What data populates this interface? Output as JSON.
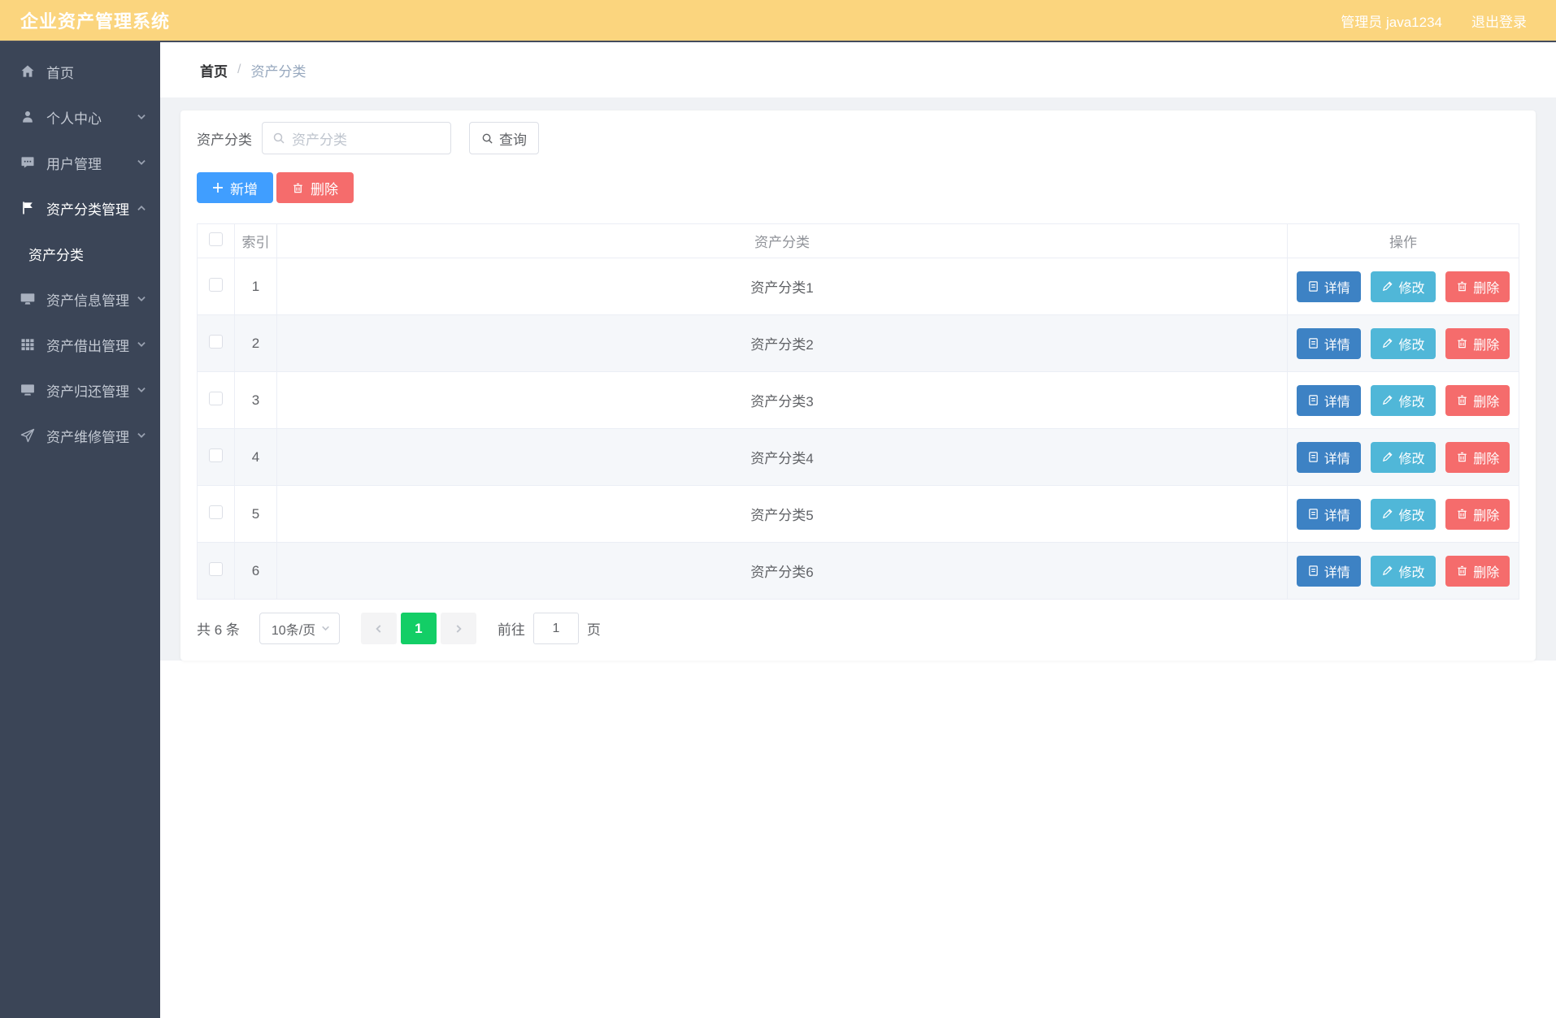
{
  "colors": {
    "header_bg": "#fbd57e",
    "sidebar_bg": "#3b4557",
    "primary_blue": "#409eff",
    "danger_red": "#f56c6c",
    "detail_blue": "#3d82c4",
    "edit_cyan": "#50b7d8",
    "active_page_green": "#13ce66"
  },
  "header": {
    "title": "企业资产管理系统",
    "user": "管理员 java1234",
    "logout": "退出登录"
  },
  "sidebar": {
    "items": [
      {
        "label": "首页",
        "icon": "home-icon"
      },
      {
        "label": "个人中心",
        "icon": "user-icon"
      },
      {
        "label": "用户管理",
        "icon": "chat-icon"
      },
      {
        "label": "资产分类管理",
        "icon": "flag-icon",
        "expanded": true,
        "children": [
          {
            "label": "资产分类",
            "active": true
          }
        ]
      },
      {
        "label": "资产信息管理",
        "icon": "monitor-icon"
      },
      {
        "label": "资产借出管理",
        "icon": "grid-icon"
      },
      {
        "label": "资产归还管理",
        "icon": "display-icon"
      },
      {
        "label": "资产维修管理",
        "icon": "send-icon"
      }
    ]
  },
  "breadcrumb": {
    "home": "首页",
    "separator": "/",
    "current": "资产分类"
  },
  "search": {
    "label": "资产分类",
    "placeholder": "资产分类",
    "query_label": "查询"
  },
  "toolbar": {
    "add_label": "新增",
    "delete_label": "删除"
  },
  "table": {
    "headers": {
      "index": "索引",
      "category": "资产分类",
      "actions": "操作"
    },
    "action_labels": {
      "detail": "详情",
      "edit": "修改",
      "delete": "删除"
    },
    "action_icons": [
      "document-icon",
      "pen-icon",
      "trash-icon"
    ],
    "rows": [
      {
        "index": "1",
        "category": "资产分类1"
      },
      {
        "index": "2",
        "category": "资产分类2"
      },
      {
        "index": "3",
        "category": "资产分类3"
      },
      {
        "index": "4",
        "category": "资产分类4"
      },
      {
        "index": "5",
        "category": "资产分类5"
      },
      {
        "index": "6",
        "category": "资产分类6"
      }
    ]
  },
  "pagination": {
    "total": "共 6 条",
    "page_size": "10条/页",
    "current_page": "1",
    "goto_label": "前往",
    "goto_value": "1",
    "page_unit": "页"
  }
}
